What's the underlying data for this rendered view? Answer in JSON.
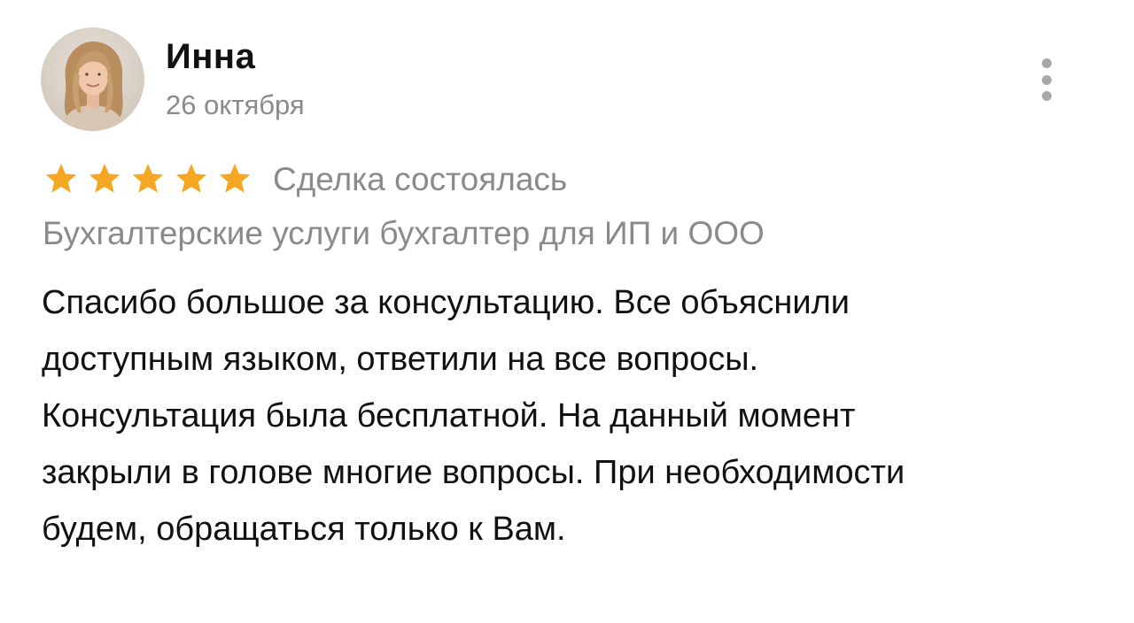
{
  "review": {
    "author": "Инна",
    "date": "26 октября",
    "rating": 5,
    "rating_max": 5,
    "status": "Сделка состоялась",
    "service": "Бухгалтерские услуги бухгалтер для ИП и ООО",
    "text_lines": [
      "Спасибо большое за консультацию. Все объяснили",
      "доступным языком, ответили на все вопросы.",
      "Консультация была бесплатной. На данный момент",
      "закрыли в голове многие вопросы. При необходимости",
      "будем, обращаться только к Вам."
    ]
  },
  "icons": {
    "menu": "more-vertical-icon",
    "rating": "star-icon"
  },
  "colors": {
    "star": "#F5A623",
    "secondary_text": "#8A8A8A",
    "primary_text": "#111111",
    "menu_dots": "#A8A8A8"
  }
}
